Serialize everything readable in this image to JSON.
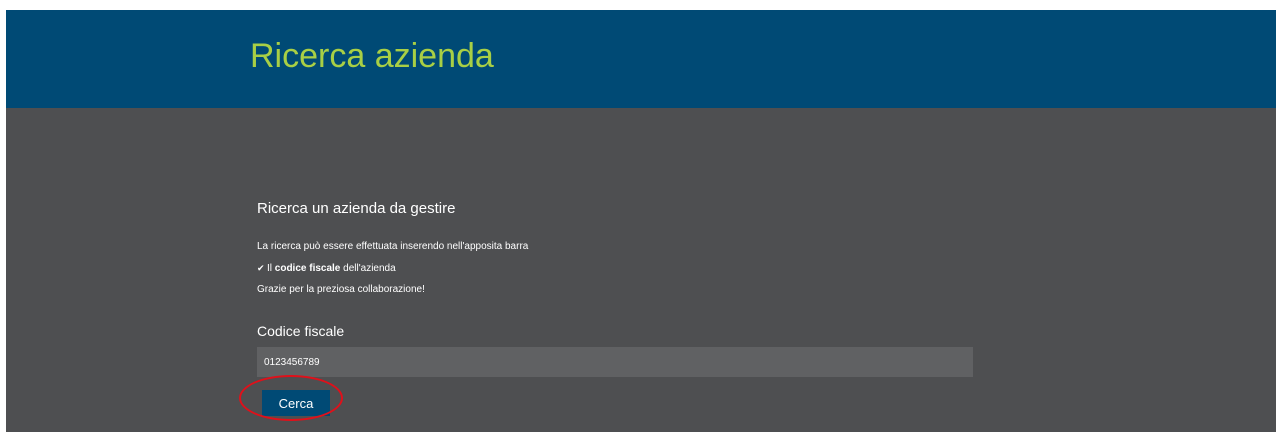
{
  "header": {
    "title": "Ricerca azienda"
  },
  "content": {
    "section_title": "Ricerca un azienda da gestire",
    "description": "La ricerca può essere effettuata inserendo nell'apposita barra",
    "bullet": {
      "icon": "check-icon",
      "prefix": "Il ",
      "bold": "codice fiscale",
      "suffix": " dell'azienda"
    },
    "thanks": "Grazie per la preziosa collaborazione!"
  },
  "form": {
    "field_label": "Codice fiscale",
    "field_value": "0123456789",
    "button_label": "Cerca"
  },
  "colors": {
    "header_bg": "#004a75",
    "title_color": "#a8cf45",
    "body_bg": "#4e4f51",
    "input_bg": "#606163",
    "highlight": "#e0101a"
  }
}
